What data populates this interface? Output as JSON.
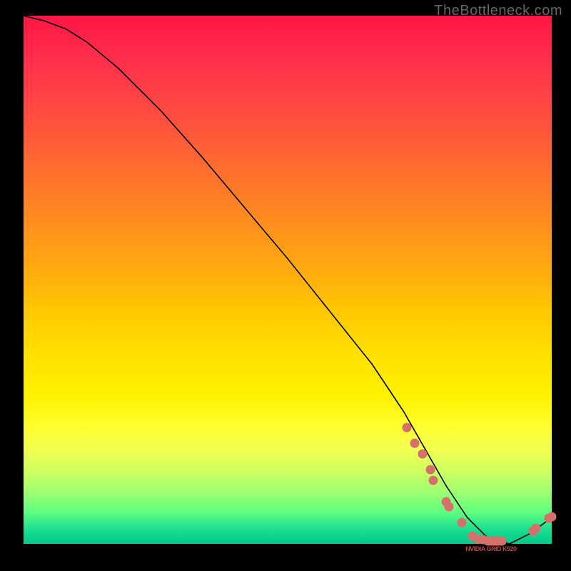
{
  "watermark": "TheBottleneck.com",
  "chart_data": {
    "type": "line",
    "title": "",
    "xlabel": "",
    "ylabel": "",
    "xlim": [
      0,
      100
    ],
    "ylim": [
      0,
      100
    ],
    "curve": {
      "x": [
        0,
        4,
        8,
        12,
        18,
        26,
        34,
        42,
        50,
        58,
        66,
        72,
        76,
        80,
        84,
        88,
        92,
        96,
        100
      ],
      "y": [
        100,
        99,
        97.5,
        95,
        90,
        82,
        73,
        63.5,
        54,
        44,
        34,
        25,
        18,
        11,
        5,
        1,
        0,
        2,
        5
      ]
    },
    "markers": [
      {
        "x": 72.5,
        "y": 22
      },
      {
        "x": 74,
        "y": 19
      },
      {
        "x": 75.5,
        "y": 17
      },
      {
        "x": 77,
        "y": 14
      },
      {
        "x": 77.5,
        "y": 12
      },
      {
        "x": 80,
        "y": 8
      },
      {
        "x": 80.5,
        "y": 7
      },
      {
        "x": 83,
        "y": 4
      },
      {
        "x": 85,
        "y": 1.5
      },
      {
        "x": 86,
        "y": 1
      },
      {
        "x": 87,
        "y": 0.8
      },
      {
        "x": 88,
        "y": 0.6
      },
      {
        "x": 88.5,
        "y": 0.5
      },
      {
        "x": 89,
        "y": 0.5
      },
      {
        "x": 89.5,
        "y": 0.5
      },
      {
        "x": 90,
        "y": 0.5
      },
      {
        "x": 90.5,
        "y": 0.5
      },
      {
        "x": 96.5,
        "y": 2.5
      },
      {
        "x": 97,
        "y": 3
      },
      {
        "x": 99.5,
        "y": 4.8
      },
      {
        "x": 100,
        "y": 5.2
      }
    ],
    "label_text": "NVIDIA GRID K520",
    "label_pos": {
      "x": 88.5,
      "y": 0.5
    }
  },
  "colors": {
    "marker": "#d6706a",
    "label": "#b84a48",
    "curve": "#000000"
  }
}
